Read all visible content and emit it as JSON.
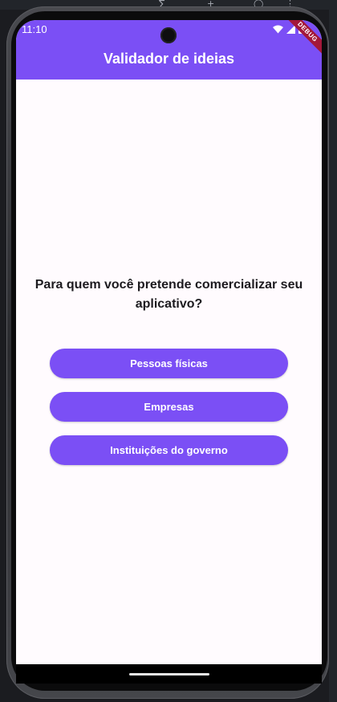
{
  "status_bar": {
    "time": "11:10",
    "icons": [
      "wifi-icon",
      "signal-icon",
      "battery-icon"
    ]
  },
  "app_bar": {
    "title": "Validador de ideias",
    "color": "#7b4ff5"
  },
  "debug_banner": {
    "label": "DEBUG",
    "color": "#a3183a"
  },
  "content": {
    "question": "Para quem você pretende comercializar seu aplicativo?",
    "options": [
      {
        "label": "Pessoas físicas"
      },
      {
        "label": "Empresas"
      },
      {
        "label": "Instituições do governo"
      }
    ]
  }
}
